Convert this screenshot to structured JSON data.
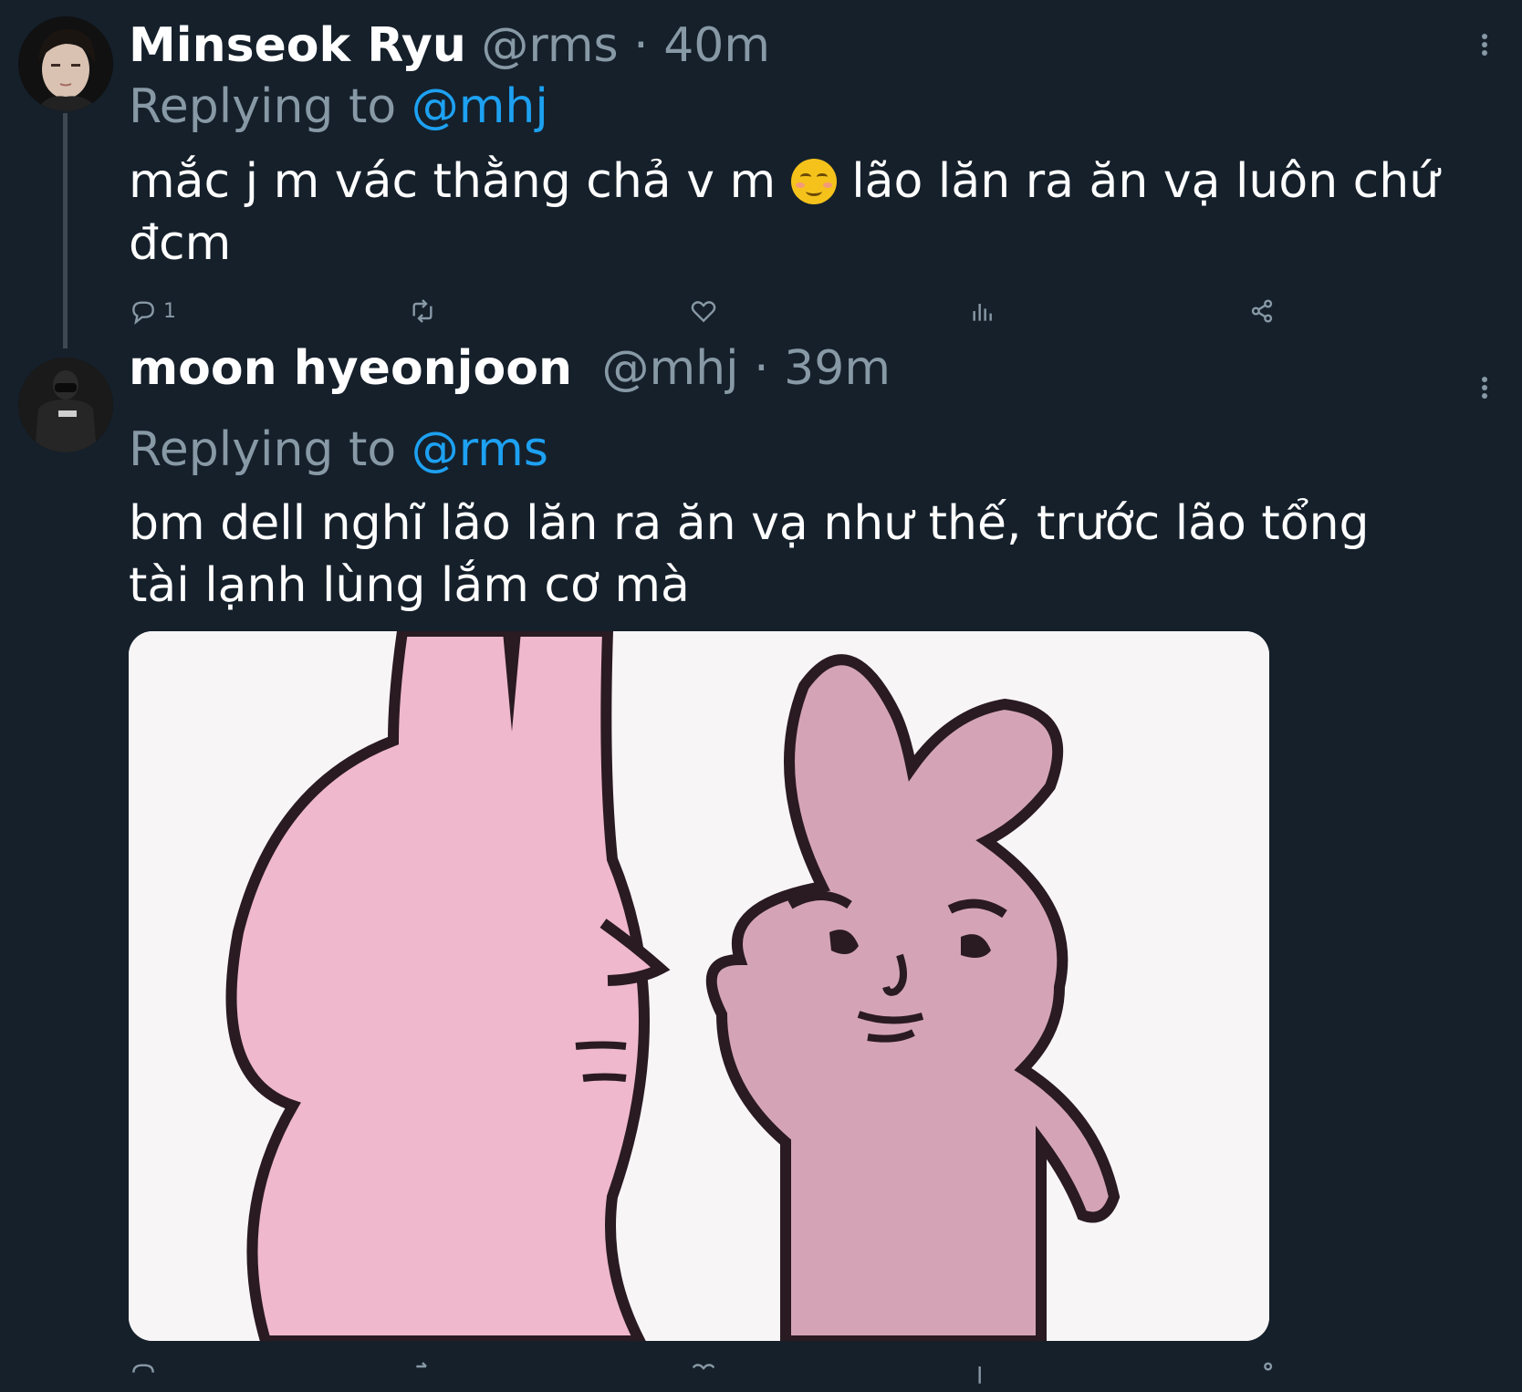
{
  "tweets": [
    {
      "name": "Minseok Ryu",
      "handle": "@rms",
      "dot": "·",
      "time": "40m",
      "replying_prefix": "Replying to ",
      "replying_to": "@mhj",
      "text_before_emoji": "mắc j m vác thằng chả v m ",
      "emoji": "smiling-face-with-blush",
      "text_after_emoji": " lão lăn ra ăn vạ luôn chứ đcm",
      "reply_count": "1",
      "icons": [
        "reply-icon",
        "retweet-icon",
        "like-icon",
        "analytics-icon",
        "share-icon",
        "more-options-icon"
      ]
    },
    {
      "name": "moon hyeonjoon",
      "handle": "@mhj",
      "dot": "·",
      "time": "39m",
      "replying_prefix": "Replying to ",
      "replying_to": "@rms",
      "text": "bm dell nghĩ lão lăn ra ăn vạ như thế, trước lão tổng tài lạnh lùng lắm cơ mà",
      "media": "pink-bunny-meme-image",
      "icons": [
        "more-options-icon"
      ]
    }
  ],
  "colors": {
    "background": "#15202b",
    "secondary_text": "#8899a6",
    "link": "#1da1f2",
    "thread_line": "#3d4852"
  }
}
